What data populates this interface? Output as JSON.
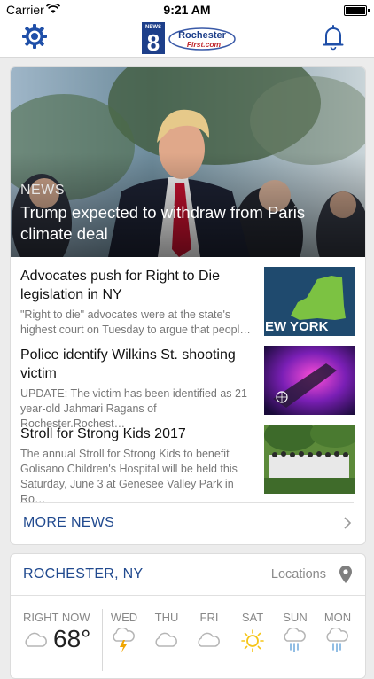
{
  "status_bar": {
    "carrier": "Carrier",
    "time": "9:21 AM"
  },
  "header": {
    "logo_top": "NEWS",
    "logo_number": "8",
    "logo_name": "Rochester",
    "logo_sub": "First.com"
  },
  "hero": {
    "category": "NEWS",
    "title": "Trump expected to withdraw from Paris climate deal"
  },
  "stories": [
    {
      "title": "Advocates push for Right to Die legislation in NY",
      "summary": "\"Right to die\" advocates were at the state's highest court on Tuesday to argue that peopl…",
      "thumb_text": "EW YORK"
    },
    {
      "title": "Police identify Wilkins St. shooting victim",
      "summary": "UPDATE: The victim has been identified as 21-year-old Jahmari Ragans of Rochester.Rochest…",
      "thumb_text": ""
    },
    {
      "title": "Stroll for Strong Kids 2017",
      "summary": "The annual Stroll for Strong Kids to benefit Golisano Children's Hospital will be held this Saturday, June 3 at Genesee Valley Park in Ro…",
      "thumb_text": ""
    }
  ],
  "more_news": {
    "label": "MORE NEWS"
  },
  "weather": {
    "city": "ROCHESTER, NY",
    "locations_label": "Locations",
    "current": {
      "label": "RIGHT NOW",
      "temp": "68°",
      "icon": "cloudy-icon"
    },
    "forecast": [
      {
        "day": "WED",
        "icon": "thunderstorm-icon"
      },
      {
        "day": "THU",
        "icon": "cloudy-icon"
      },
      {
        "day": "FRI",
        "icon": "cloudy-icon"
      },
      {
        "day": "SAT",
        "icon": "sunny-icon"
      },
      {
        "day": "SUN",
        "icon": "rain-icon"
      },
      {
        "day": "MON",
        "icon": "rain-icon"
      }
    ]
  },
  "colors": {
    "accent": "#214a8f",
    "sun": "#f5c518",
    "rain": "#6fa8dc",
    "bolt": "#f0a500"
  }
}
